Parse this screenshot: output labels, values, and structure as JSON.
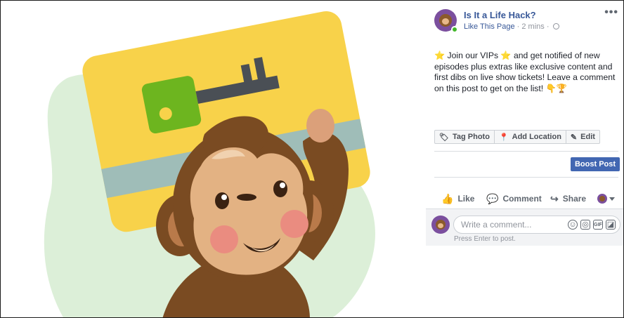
{
  "post": {
    "page_name": "Is It a Life Hack?",
    "like_page": "Like This Page",
    "separator": "·",
    "time": "2 mins",
    "separator2": "·",
    "more": "•••",
    "body": "⭐ Join our VIPs ⭐ and get notified of new episodes plus extras like exclusive content and first dibs on live show tickets! Leave a comment on this post to get on the list! 👇🏆"
  },
  "photo_actions": {
    "tag_photo": "Tag Photo",
    "add_location": "Add Location",
    "edit": "Edit"
  },
  "boost": {
    "label": "Boost Post"
  },
  "reactions": {
    "like": "Like",
    "comment": "Comment",
    "share": "Share"
  },
  "comment_box": {
    "placeholder": "Write a comment...",
    "hint": "Press Enter to post."
  },
  "icons": {
    "tag": "tag-icon",
    "location": "map-pin-icon",
    "edit": "pencil-icon",
    "like": "thumbs-up-icon",
    "comment": "speech-bubble-icon",
    "share": "share-arrow-icon",
    "globe": "globe-icon",
    "emoji": "smiley-icon",
    "camera": "camera-icon",
    "gif": "gif-icon",
    "sticker": "sticker-icon"
  },
  "colors": {
    "link": "#385898",
    "boost": "#4267b2",
    "card": "#f8d24a",
    "key_green": "#6db51f",
    "monkey_brown": "#7a4b22",
    "blob_green": "#dcefd8"
  }
}
